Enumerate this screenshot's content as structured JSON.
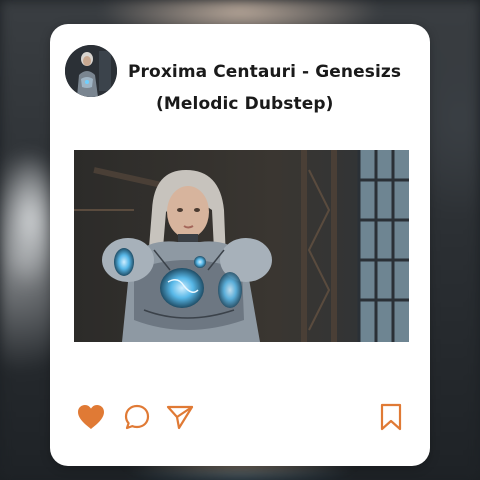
{
  "post": {
    "title_line1": "Proxima Centauri - Genesizs",
    "title_line2": "(Melodic Dubstep)"
  },
  "icons": {
    "like": "heart-icon",
    "comment": "comment-icon",
    "share": "send-icon",
    "save": "bookmark-icon"
  },
  "colors": {
    "accent": "#e07a35",
    "card": "#ffffff",
    "text": "#1a1a1a"
  }
}
